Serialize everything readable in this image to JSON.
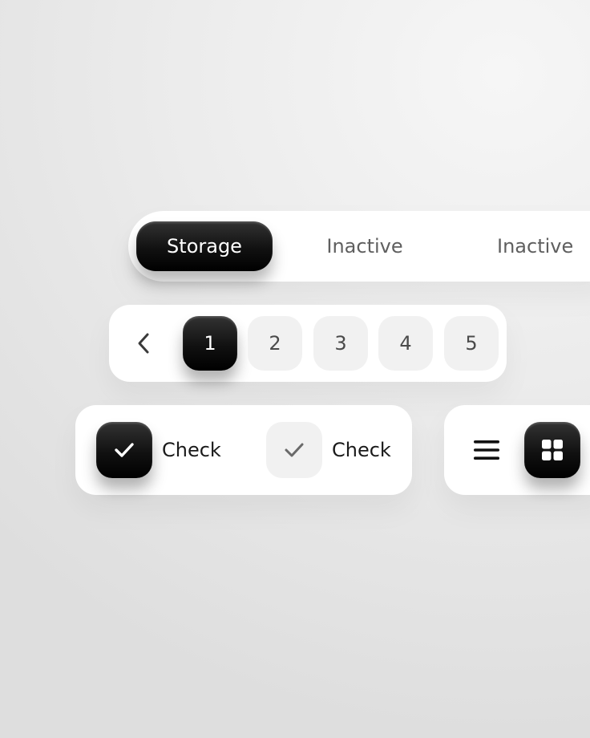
{
  "tabs": {
    "items": [
      {
        "label": "Storage",
        "active": true
      },
      {
        "label": "Inactive",
        "active": false
      },
      {
        "label": "Inactive",
        "active": false
      }
    ]
  },
  "pagination": {
    "prev_icon": "chevron-left-icon",
    "pages": [
      "1",
      "2",
      "3",
      "4",
      "5"
    ],
    "current": "1"
  },
  "checkboxes": {
    "items": [
      {
        "label": "Check",
        "checked": true,
        "icon": "check-icon"
      },
      {
        "label": "Check",
        "checked": false,
        "icon": "check-icon"
      }
    ]
  },
  "view_toggle": {
    "options": [
      {
        "icon": "list-icon",
        "selected": false
      },
      {
        "icon": "grid-icon",
        "selected": true
      }
    ]
  },
  "colors": {
    "active_fill": "#111111",
    "inactive_text": "#5f5f5f",
    "inactive_fill": "#f1f1f1",
    "card": "#ffffff"
  }
}
